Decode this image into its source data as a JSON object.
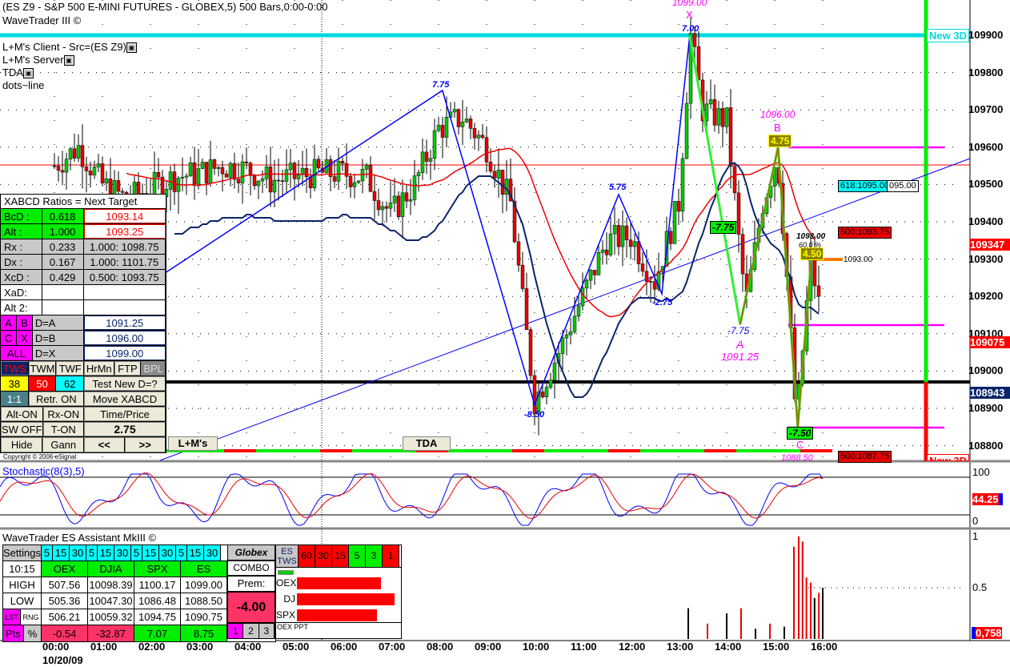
{
  "header": {
    "title": "(ES Z9 - S&P 500 E-MINI FUTURES - GLOBEX,5) 500 Bars,0:00-0:00",
    "subtitle": "WaveTrader III ©",
    "studies": [
      "L+M's Client - Src=(ES Z9)",
      "L+M's Server",
      "TDA",
      "dots~line"
    ]
  },
  "price_axis": {
    "ticks": [
      "109900",
      "109800",
      "109700",
      "109600",
      "109500",
      "109400",
      "109300",
      "109200",
      "109100",
      "109000",
      "108900",
      "108800"
    ],
    "flags": [
      {
        "text": "109347",
        "color": "#ff0000"
      },
      {
        "text": "109075",
        "color": "#ff0000"
      },
      {
        "text": "108943",
        "color": "#0a246a"
      }
    ]
  },
  "chart_labels": {
    "x_label": "1099.00",
    "x_letter": "X",
    "x_val": "7.00",
    "b_label": "1096.00",
    "b_letter": "B",
    "b_val": "4.75",
    "a_val": "-7.75",
    "a_letter": "A",
    "a_label": "1091.25",
    "c_val": "-7.50",
    "c_letter": "C",
    "c_label": "1088.50",
    "ab_box": "-7.75",
    "d_box": "4.50",
    "d_target": "1093.00",
    "d_pct": "60.0 %",
    "z1": "7.75",
    "z2": "-8.50",
    "z3": "5.75",
    "z4": "-2.75",
    "new3d_top": "New 3D",
    "new3d_bot": "New 3D",
    "fib618": "618:1095.00",
    "fib618b": "095.00",
    "fib500a": "500:1093.75",
    "fib500b": "500:1087.75",
    "orange": "1093.00",
    "copyright": "Copyright © 2006 eSignal"
  },
  "left_panel": {
    "title": "XABCD Ratios = Next Target",
    "rows": [
      {
        "k": "BcD :",
        "v": "0.618",
        "t": "1093.14"
      },
      {
        "k": "Alt  :",
        "v": "1.000",
        "t": "1093.25"
      },
      {
        "k": "Rx  :",
        "v": "0.233",
        "t": "1.000: 1098.75"
      },
      {
        "k": "Dx  :",
        "v": "0.167",
        "t": "1.000: 1101.75"
      },
      {
        "k": "XcD :",
        "v": "0.429",
        "t": "0.500: 1093.75"
      },
      {
        "k": "XaD:",
        "v": "",
        "t": ""
      },
      {
        "k": "Alt 2:",
        "v": "",
        "t": ""
      }
    ],
    "d_rows": [
      {
        "a": "A",
        "b": "B",
        "k": "D=A",
        "t": "1091.25"
      },
      {
        "a": "C",
        "b": "X",
        "k": "D=B",
        "t": "1096.00"
      },
      {
        "a": "ALL",
        "b": "",
        "k": "D=X",
        "t": "1099.00"
      }
    ],
    "buttons": {
      "tws": "TWS",
      "twm": "TWM",
      "twf": "TWF",
      "hrmn": "HrMn",
      "ftp": "FTP",
      "bpl": "BPL",
      "f38": "38",
      "f50": "50",
      "f62": "62",
      "test": "Test New D=?",
      "one": "1:1",
      "retr": "Retr. ON",
      "move": "Move XABCD",
      "alt": "Alt-ON",
      "rx": "Rx-ON",
      "tp": "Time/Price",
      "sw": "SW OFF",
      "ton": "T-ON",
      "val": "2.75",
      "hide": "Hide",
      "gann": "Gann",
      "prev": "<<",
      "next": ">>"
    },
    "tabs": [
      "L+M's",
      "TDA"
    ]
  },
  "stochastic": {
    "title": "Stochastic(8(3),5)",
    "ticks": [
      "100",
      "0"
    ],
    "value": "44.25"
  },
  "assistant": {
    "title": "WaveTrader ES Assistant MkIII ©",
    "settings": "Settings",
    "tf": [
      "5",
      "15",
      "30"
    ],
    "time": "10:15",
    "cols": [
      "OEX",
      "DJIA",
      "SPX",
      "ES"
    ],
    "globex": "Globex",
    "combo": "COMBO",
    "prem": "Prem:",
    "prem_val": "-4.00",
    "rows": [
      {
        "k": "HIGH",
        "v": [
          "507.56",
          "10098.39",
          "1100.17",
          "1099.00"
        ]
      },
      {
        "k": "LOW",
        "v": [
          "505.36",
          "10047.30",
          "1086.48",
          "1088.50"
        ]
      },
      {
        "k": "LST",
        "k2": "RNG",
        "v": [
          "506.21",
          "10059.32",
          "1094.75",
          "1090.75"
        ]
      }
    ],
    "pts": "Pts",
    "pct": "%",
    "chg": [
      "-0.54",
      "-32.87",
      "7.07",
      "8.75"
    ],
    "pages": [
      "1",
      "2",
      "3"
    ],
    "es_tws": "ES TWS",
    "tws_tf": [
      {
        "t": "60",
        "c": "#ff0000"
      },
      {
        "t": "30",
        "c": "#ff0000"
      },
      {
        "t": "15",
        "c": "#ff0000"
      },
      {
        "t": "5",
        "c": "#00ee00"
      },
      {
        "t": "3",
        "c": "#00ee00"
      },
      {
        "t": "1",
        "c": "#ff0000"
      }
    ],
    "bars": [
      {
        "k": "OEX",
        "v": 0.82
      },
      {
        "k": "DJ",
        "v": 0.95
      },
      {
        "k": "SPX",
        "v": 0.78
      }
    ],
    "oex_ppt": "OEX PPT",
    "axis": [
      "1",
      "0.5"
    ],
    "value": "0,758"
  },
  "time_axis": {
    "labels": [
      "00:00",
      "01:00",
      "02:00",
      "03:00",
      "04:00",
      "05:00",
      "06:00",
      "07:00",
      "08:00",
      "09:00",
      "10:00",
      "11:00",
      "12:00",
      "13:00",
      "14:00",
      "15:00",
      "16:00"
    ],
    "date": "10/20/09"
  },
  "chart_data": {
    "type": "candlestick",
    "price_path": [
      [
        0,
        1095.5
      ],
      [
        0.5,
        1096
      ],
      [
        1,
        1095
      ],
      [
        1.5,
        1094.6
      ],
      [
        2,
        1094.9
      ],
      [
        2.5,
        1095.2
      ],
      [
        3,
        1095.3
      ],
      [
        3.5,
        1095.5
      ],
      [
        4,
        1095.4
      ],
      [
        4.5,
        1095.1
      ],
      [
        5,
        1095.2
      ],
      [
        5.5,
        1095.3
      ],
      [
        6,
        1095.3
      ],
      [
        6.5,
        1095.2
      ],
      [
        7,
        1094.2
      ],
      [
        7.5,
        1095
      ],
      [
        8,
        1096.5
      ],
      [
        8.5,
        1096.8
      ],
      [
        9,
        1096
      ],
      [
        9.5,
        1094.5
      ],
      [
        10,
        1089.2
      ],
      [
        10.5,
        1090.5
      ],
      [
        11,
        1092
      ],
      [
        11.5,
        1093.5
      ],
      [
        12,
        1093.6
      ],
      [
        12.5,
        1092.4
      ],
      [
        13,
        1094.5
      ],
      [
        13.25,
        1099
      ],
      [
        13.5,
        1097
      ],
      [
        14,
        1096.7
      ],
      [
        14.25,
        1093.5
      ],
      [
        14.4,
        1091.8
      ],
      [
        14.75,
        1094.5
      ],
      [
        15.05,
        1095.8
      ],
      [
        15.2,
        1093.5
      ],
      [
        15.45,
        1088.6
      ],
      [
        15.75,
        1093
      ],
      [
        16,
        1091.2
      ]
    ],
    "zigzag": [
      [
        2.33,
        1092.65
      ],
      [
        8.08,
        1097.52
      ],
      [
        10,
        1089.1
      ],
      [
        11.75,
        1094.73
      ],
      [
        12.65,
        1092.07
      ],
      [
        13.23,
        1098.98
      ]
    ],
    "xabcd": [
      [
        13.23,
        1098.98
      ],
      [
        14.28,
        1091.25
      ],
      [
        15.07,
        1096
      ],
      [
        15.48,
        1088.5
      ],
      [
        15.78,
        1093.3
      ]
    ],
    "volume_ratio": [
      [
        13.2,
        0.3,
        "k"
      ],
      [
        13.6,
        0.15,
        "r"
      ],
      [
        14,
        0.25,
        "k"
      ],
      [
        14.3,
        0.3,
        "r"
      ],
      [
        14.6,
        0.1,
        "k"
      ],
      [
        14.9,
        0.15,
        "r"
      ],
      [
        15.2,
        0.12,
        "k"
      ],
      [
        15.4,
        0.9,
        "r"
      ],
      [
        15.5,
        1.0,
        "r"
      ],
      [
        15.58,
        0.95,
        "r"
      ],
      [
        15.66,
        0.6,
        "r"
      ],
      [
        15.75,
        0.55,
        "r"
      ],
      [
        15.83,
        0.4,
        "k"
      ],
      [
        15.92,
        0.45,
        "r"
      ],
      [
        16,
        0.5,
        "k"
      ]
    ]
  }
}
